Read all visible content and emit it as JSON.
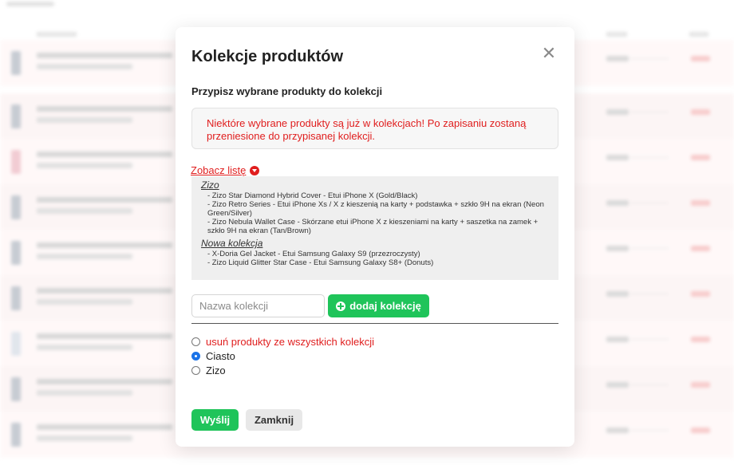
{
  "modal": {
    "title": "Kolekcje produktów",
    "subtitle": "Przypisz wybrane produkty do kolekcji",
    "warning": "Niektóre wybrane produkty są już w kolekcjach! Po zapisaniu zostaną przeniesione do przypisanej kolekcji.",
    "see_list_label": "Zobacz listę",
    "collections": [
      {
        "name": "Zizo",
        "items": [
          "- Zizo Star Diamond Hybrid Cover - Etui iPhone X (Gold/Black)",
          "- Zizo Retro Series - Etui iPhone Xs / X z kieszenią na karty + podstawka + szkło 9H na ekran (Neon Green/Silver)",
          "- Zizo Nebula Wallet Case - Skórzane etui iPhone X z kieszeniami na karty + saszetka na zamek + szkło 9H na ekran (Tan/Brown)"
        ]
      },
      {
        "name": "Nowa kolekcja",
        "items": [
          "- X-Doria Gel Jacket - Etui Samsung Galaxy S9 (przezroczysty)",
          "- Zizo Liquid Glitter Star Case - Etui Samsung Galaxy S8+ (Donuts)"
        ]
      }
    ],
    "collection_name_input": {
      "value": "",
      "placeholder": "Nazwa kolekcji"
    },
    "add_collection_label": "dodaj kolekcję",
    "radio_options": [
      {
        "label": "usuń produkty ze wszystkich kolekcji",
        "checked": false,
        "emphasis": "red"
      },
      {
        "label": "Ciasto",
        "checked": true
      },
      {
        "label": "Zizo",
        "checked": false
      }
    ],
    "submit_label": "Wyślij",
    "close_label": "Zamknij"
  },
  "colors": {
    "accent_green": "#1fc45a",
    "warning_red": "#e01e1e",
    "radio_blue": "#1a73e8"
  },
  "icons": {
    "close": "close-icon",
    "see_list": "chevron-down-circle-icon",
    "add": "plus-circle-icon"
  }
}
